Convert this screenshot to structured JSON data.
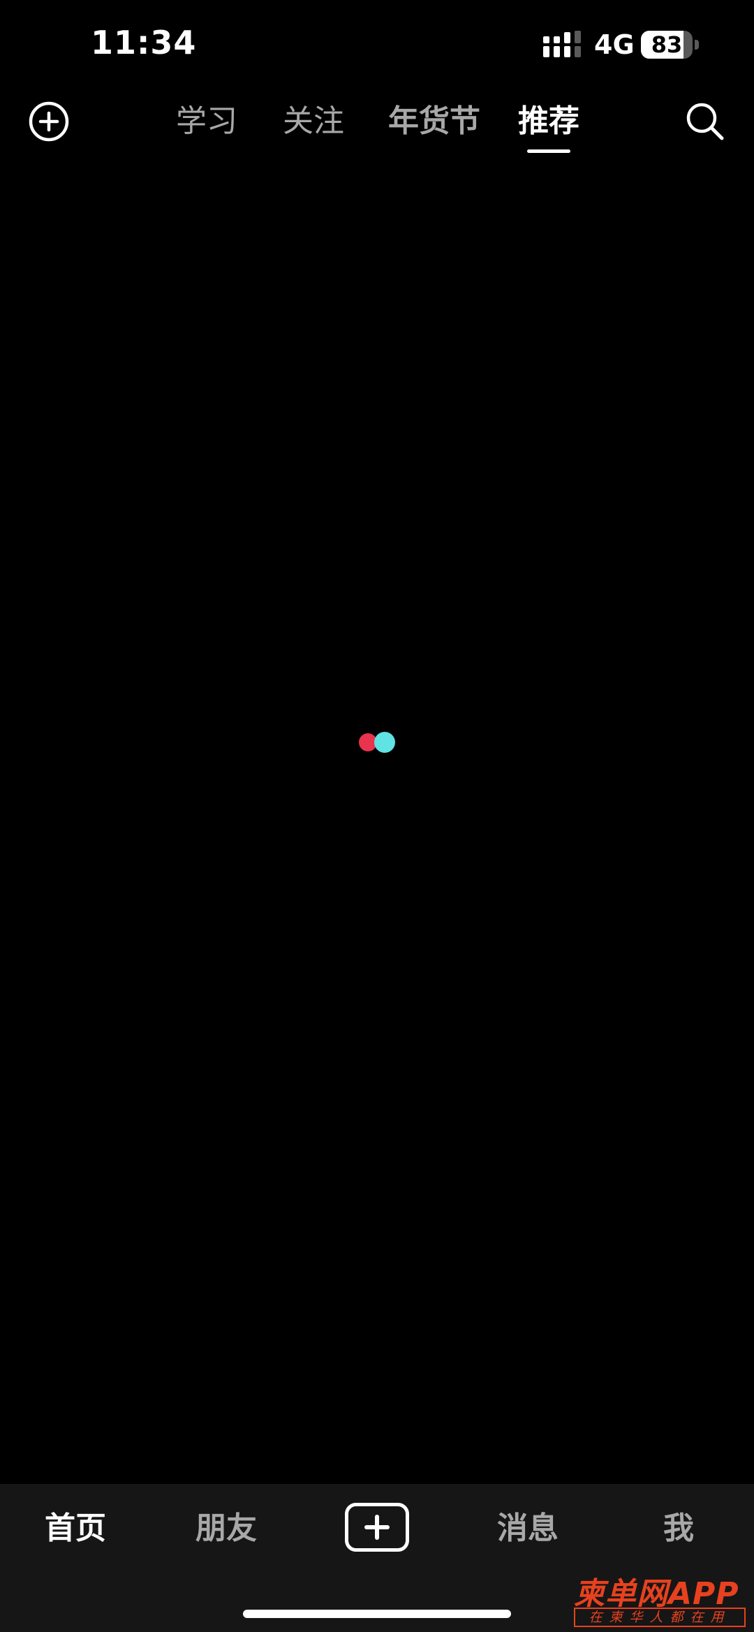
{
  "status_bar": {
    "time": "11:34",
    "network": "4G",
    "battery_percent": 83,
    "battery_label": "83",
    "signal_icon": "cellular-signal-icon"
  },
  "top_nav": {
    "add_icon": "plus-circle-icon",
    "search_icon": "search-icon",
    "tabs": [
      {
        "label": "学习",
        "active": false
      },
      {
        "label": "关注",
        "active": false
      },
      {
        "label": "年货节",
        "active": false
      },
      {
        "label": "推荐",
        "active": true
      }
    ]
  },
  "loading": {
    "colors": {
      "red": "#e8344e",
      "cyan": "#5fe3e3"
    }
  },
  "bottom_nav": {
    "items": [
      {
        "label": "首页",
        "active": true
      },
      {
        "label": "朋友",
        "active": false
      },
      {
        "label": "消息",
        "active": false
      },
      {
        "label": "我",
        "active": false
      }
    ],
    "create_icon": "plus-square-icon"
  },
  "watermark": {
    "logo": "柬单网APP",
    "slogan": "在柬华人都在用"
  },
  "colors": {
    "background": "#000000",
    "bottom_bar": "#161616",
    "inactive_text": "#a8a8a8",
    "active_text": "#ffffff",
    "watermark": "#e8411f"
  }
}
